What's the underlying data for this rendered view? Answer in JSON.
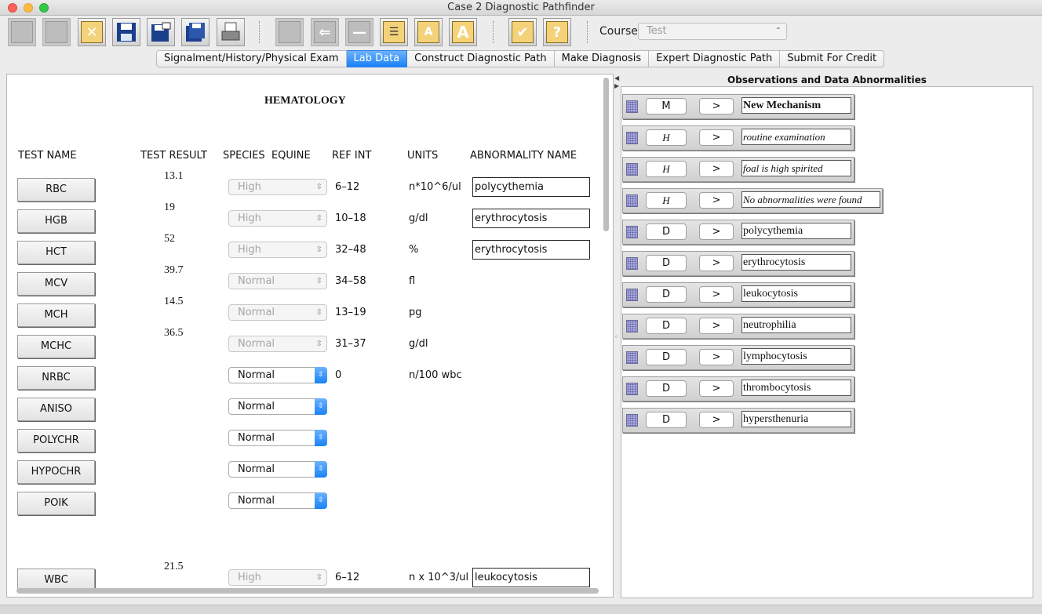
{
  "window": {
    "title": "Case 2 Diagnostic Pathfinder"
  },
  "course": {
    "label": "Course",
    "value": "Test"
  },
  "tabs": [
    {
      "label": "Signalment/History/Physical Exam",
      "active": false
    },
    {
      "label": "Lab Data",
      "active": true
    },
    {
      "label": "Construct Diagnostic Path",
      "active": false
    },
    {
      "label": "Make Diagnosis",
      "active": false
    },
    {
      "label": "Expert Diagnostic Path",
      "active": false
    },
    {
      "label": "Submit For Credit",
      "active": false
    }
  ],
  "toolbar_icons": {
    "close_case": "x-icon",
    "save": "floppy-disk-icon",
    "save_as": "save-as-icon",
    "save_all": "save-all-icon",
    "print": "printer-icon",
    "delete": "trash-icon",
    "back": "back-arrow-icon",
    "remove": "minus-icon",
    "list": "list-icon",
    "font_smaller": "A",
    "font_larger": "A",
    "check": "✔",
    "help": "?"
  },
  "lab": {
    "section_title": "HEMATOLOGY",
    "headers": {
      "test_name": "TEST NAME",
      "test_result": "TEST RESULT",
      "species": "SPECIES  EQUINE",
      "ref_int": "REF INT",
      "units": "UNITS",
      "abnormality": "ABNORMALITY NAME"
    },
    "rows": [
      {
        "test": "RBC",
        "result": "13.1",
        "status": "High",
        "enabled": false,
        "ref": "6–12",
        "units": "n*10^6/ul",
        "abnormality": "polycythemia"
      },
      {
        "test": "HGB",
        "result": "19",
        "status": "High",
        "enabled": false,
        "ref": "10–18",
        "units": "g/dl",
        "abnormality": "erythrocytosis"
      },
      {
        "test": "HCT",
        "result": "52",
        "status": "High",
        "enabled": false,
        "ref": "32–48",
        "units": "%",
        "abnormality": "erythrocytosis"
      },
      {
        "test": "MCV",
        "result": "39.7",
        "status": "Normal",
        "enabled": false,
        "ref": "34–58",
        "units": "fl",
        "abnormality": ""
      },
      {
        "test": "MCH",
        "result": "14.5",
        "status": "Normal",
        "enabled": false,
        "ref": "13–19",
        "units": "pg",
        "abnormality": ""
      },
      {
        "test": "MCHC",
        "result": "36.5",
        "status": "Normal",
        "enabled": false,
        "ref": "31–37",
        "units": "g/dl",
        "abnormality": ""
      },
      {
        "test": "NRBC",
        "result": "",
        "status": "Normal",
        "enabled": true,
        "ref": "0",
        "units": "n/100 wbc",
        "abnormality": ""
      },
      {
        "test": "ANISO",
        "result": "",
        "status": "Normal",
        "enabled": true,
        "ref": "",
        "units": "",
        "abnormality": ""
      },
      {
        "test": "POLYCHR",
        "result": "",
        "status": "Normal",
        "enabled": true,
        "ref": "",
        "units": "",
        "abnormality": ""
      },
      {
        "test": "HYPOCHR",
        "result": "",
        "status": "Normal",
        "enabled": true,
        "ref": "",
        "units": "",
        "abnormality": ""
      },
      {
        "test": "POIK",
        "result": "",
        "status": "Normal",
        "enabled": true,
        "ref": "",
        "units": "",
        "abnormality": ""
      },
      {
        "test": "WBC",
        "result": "21.5",
        "status": "High",
        "enabled": false,
        "ref": "6–12",
        "units": "n x 10^3/ul",
        "abnormality": "leukocytosis"
      }
    ]
  },
  "observations": {
    "title": "Observations and Data Abnormalities",
    "go_label": ">",
    "items": [
      {
        "code": "M",
        "text": "New Mechanism",
        "style": "bold"
      },
      {
        "code": "H",
        "text": "routine examination",
        "style": "italic"
      },
      {
        "code": "H",
        "text": "foal is high spirited",
        "style": "italic"
      },
      {
        "code": "H",
        "text": "No abnormalities were found",
        "style": "italic"
      },
      {
        "code": "D",
        "text": "polycythemia",
        "style": "plain"
      },
      {
        "code": "D",
        "text": "erythrocytosis",
        "style": "plain"
      },
      {
        "code": "D",
        "text": "leukocytosis",
        "style": "plain"
      },
      {
        "code": "D",
        "text": "neutrophilia",
        "style": "plain"
      },
      {
        "code": "D",
        "text": "lymphocytosis",
        "style": "plain"
      },
      {
        "code": "D",
        "text": "thrombocytosis",
        "style": "plain"
      },
      {
        "code": "D",
        "text": "hypersthenuria",
        "style": "plain"
      }
    ]
  },
  "colors": {
    "accent_blue": "#1a82f7",
    "icon_yellow": "#f3d27a",
    "grip_purple": "#b6b6e6"
  }
}
